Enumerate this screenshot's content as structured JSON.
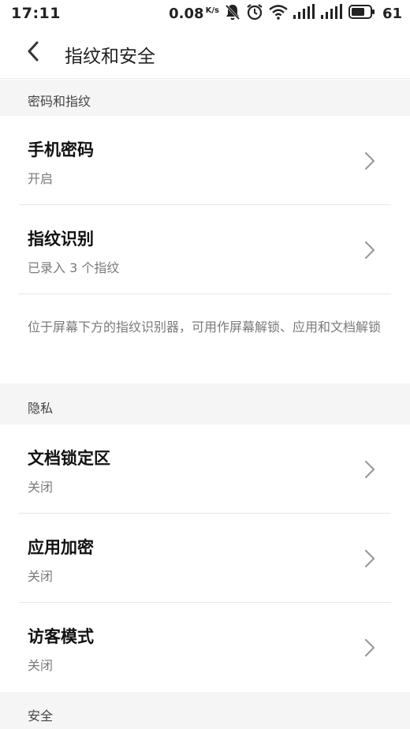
{
  "status_bar": {
    "time": "17:11",
    "speed_value": "0.08",
    "speed_unit": "K/s",
    "battery_level": "61"
  },
  "header": {
    "title": "指纹和安全"
  },
  "sections": {
    "password_fingerprint": {
      "title": "密码和指纹",
      "items": [
        {
          "title": "手机密码",
          "subtitle": "开启"
        },
        {
          "title": "指纹识别",
          "subtitle": "已录入 3 个指纹"
        }
      ],
      "description": "位于屏幕下方的指纹识别器，可用作屏幕解锁、应用和文档解锁"
    },
    "privacy": {
      "title": "隐私",
      "items": [
        {
          "title": "文档锁定区",
          "subtitle": "关闭"
        },
        {
          "title": "应用加密",
          "subtitle": "关闭"
        },
        {
          "title": "访客模式",
          "subtitle": "关闭"
        }
      ]
    },
    "security": {
      "title": "安全"
    }
  },
  "icons": {
    "back": "chevron-left-icon",
    "row": "chevron-right-icon",
    "mute": "bell-off-icon",
    "alarm": "alarm-icon",
    "wifi": "wifi-icon",
    "signal": "signal-icon",
    "battery": "battery-icon"
  }
}
